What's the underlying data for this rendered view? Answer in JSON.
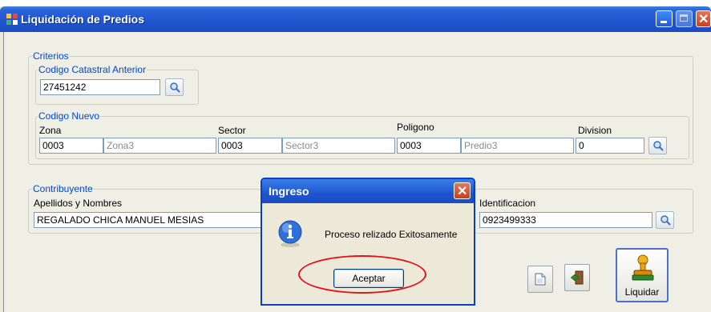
{
  "window": {
    "title": "Liquidación de Predios"
  },
  "criterios": {
    "legend": "Criterios",
    "anterior": {
      "legend": "Codigo Catastral Anterior",
      "value": "27451242"
    },
    "nuevo": {
      "legend": "Codigo Nuevo",
      "zona_label": "Zona",
      "zona_code": "0003",
      "zona_name": "Zona3",
      "sector_label": "Sector",
      "sector_code": "0003",
      "sector_name": "Sector3",
      "poligono_label": "Poligono",
      "poligono_code": "0003",
      "poligono_name": "Predio3",
      "division_label": "Division",
      "division_value": "0"
    }
  },
  "contribuyente": {
    "legend": "Contribuyente",
    "nombres_label": "Apellidos y Nombres",
    "nombres_value": "REGALADO CHICA MANUEL MESIAS",
    "id_label": "Identificacion",
    "id_value": "0923499333"
  },
  "toolbar": {
    "liquidar_label": "Liquidar"
  },
  "dialog": {
    "title": "Ingreso",
    "message": "Proceso relizado Exitosamente",
    "ok_label": "Aceptar"
  },
  "colors": {
    "titlebar": "#1f55cf",
    "group_label": "#0046d5",
    "highlight": "#e0141a"
  },
  "icons": [
    "app-icon",
    "search-icon",
    "new-document-icon",
    "exit-door-icon",
    "liquidar-stamp-icon",
    "info-icon",
    "close-icon"
  ]
}
